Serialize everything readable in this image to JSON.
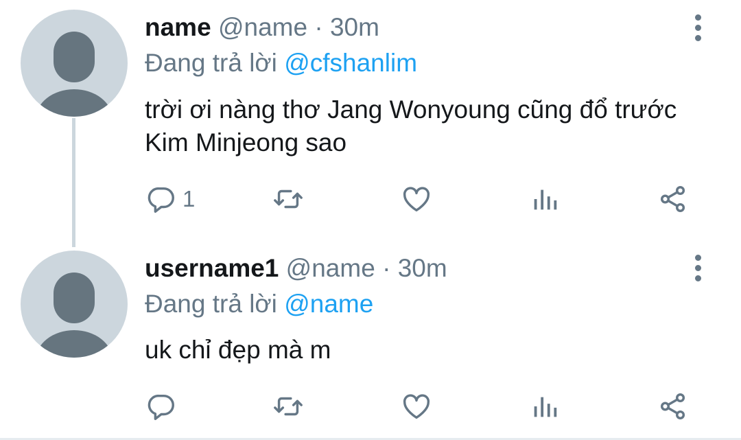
{
  "colors": {
    "text_primary": "#14171a",
    "text_secondary": "#657786",
    "link": "#1da1f2",
    "avatar_bg": "#ccd6dd",
    "avatar_fg": "#66757f"
  },
  "tweets": [
    {
      "display_name": "name",
      "handle": "@name",
      "separator": "·",
      "time": "30m",
      "reply_prefix": "Đang trả lời",
      "reply_to": "@cfshanlim",
      "text": "trời ơi nàng thơ Jang Wonyoung cũng đổ trước Kim Minjeong sao",
      "reply_count": "1",
      "icons": [
        "default-avatar-icon",
        "more-options-icon",
        "reply-icon",
        "retweet-icon",
        "like-icon",
        "analytics-icon",
        "share-icon"
      ]
    },
    {
      "display_name": "username1",
      "handle": "@name",
      "separator": "·",
      "time": "30m",
      "reply_prefix": "Đang trả lời",
      "reply_to": "@name",
      "text": "uk chỉ đẹp mà m",
      "reply_count": "",
      "icons": [
        "default-avatar-icon",
        "more-options-icon",
        "reply-icon",
        "retweet-icon",
        "like-icon",
        "analytics-icon",
        "share-icon"
      ]
    }
  ]
}
